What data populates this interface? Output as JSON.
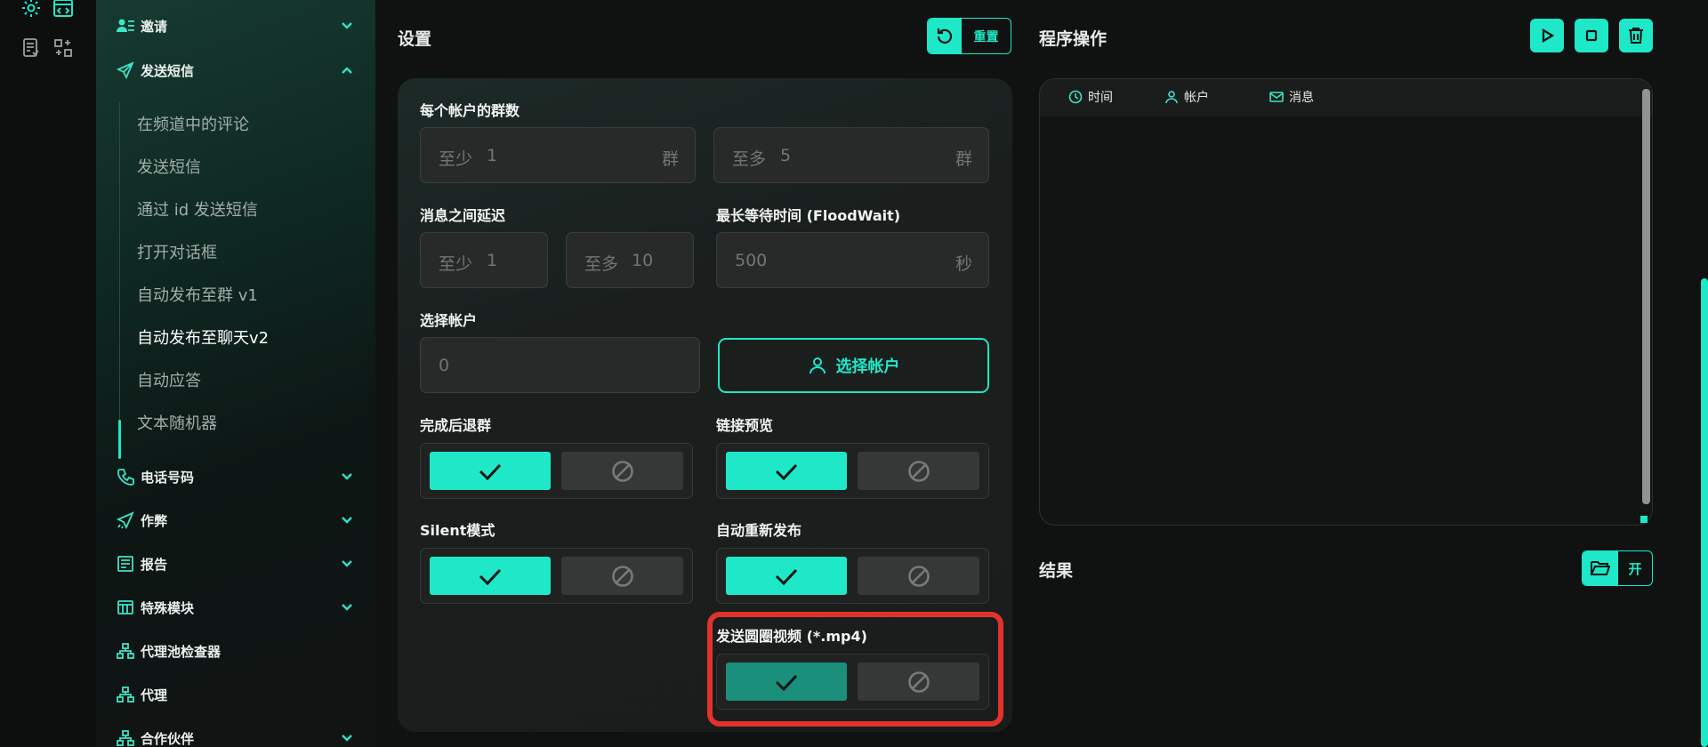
{
  "sidebar": {
    "groups_top": [
      {
        "label": "邀请",
        "expanded": false,
        "icon": "users-list-icon"
      },
      {
        "label": "发送短信",
        "expanded": true,
        "icon": "paper-plane-icon"
      }
    ],
    "sub_items": [
      {
        "label": "在频道中的评论"
      },
      {
        "label": "发送短信"
      },
      {
        "label": "通过 id 发送短信"
      },
      {
        "label": "打开对话框"
      },
      {
        "label": "自动发布至群 v1"
      },
      {
        "label": "自动发布至聊天v2",
        "active": true
      },
      {
        "label": "自动应答"
      },
      {
        "label": "文本随机器"
      }
    ],
    "groups_bottom": [
      {
        "label": "电话号码",
        "icon": "phone-icon",
        "chevron": true
      },
      {
        "label": "作弊",
        "icon": "magic-plane-icon",
        "chevron": true
      },
      {
        "label": "报告",
        "icon": "report-icon",
        "chevron": true
      },
      {
        "label": "特殊模块",
        "icon": "table-icon",
        "chevron": true
      },
      {
        "label": "代理池检查器",
        "icon": "network-icon",
        "chevron": false
      },
      {
        "label": "代理",
        "icon": "network-icon",
        "chevron": false
      },
      {
        "label": "合作伙伴",
        "icon": "network-icon",
        "chevron": true
      }
    ]
  },
  "settings": {
    "title": "设置",
    "reset_label": "重置",
    "groups_per_account": {
      "label": "每个帐户的群数",
      "min_prefix": "至少",
      "min_value": "1",
      "min_suffix": "群",
      "max_prefix": "至多",
      "max_value": "5",
      "max_suffix": "群"
    },
    "message_delay": {
      "label": "消息之间延迟",
      "min_prefix": "至少",
      "min_value": "1",
      "max_prefix": "至多",
      "max_value": "10"
    },
    "flood_wait": {
      "label": "最长等待时间 (FloodWait)",
      "value": "500",
      "suffix": "秒"
    },
    "select_account": {
      "label": "选择帐户",
      "value": "0",
      "button_label": "选择帐户"
    },
    "toggles": {
      "leave_after": {
        "label": "完成后退群",
        "enabled": true
      },
      "link_preview": {
        "label": "链接预览",
        "enabled": true
      },
      "silent_mode": {
        "label": "Silent模式",
        "enabled": true
      },
      "auto_repost": {
        "label": "自动重新发布",
        "enabled": true
      },
      "round_video": {
        "label": "发送圆圈视频 (*.mp4)",
        "enabled": true
      }
    }
  },
  "operations": {
    "title": "程序操作",
    "log_columns": [
      "时间",
      "帐户",
      "消息"
    ]
  },
  "results": {
    "title": "结果",
    "open_label": "开"
  },
  "colors": {
    "accent": "#1ee8c8",
    "highlight_border": "#e0332c",
    "background": "#0f1211"
  }
}
